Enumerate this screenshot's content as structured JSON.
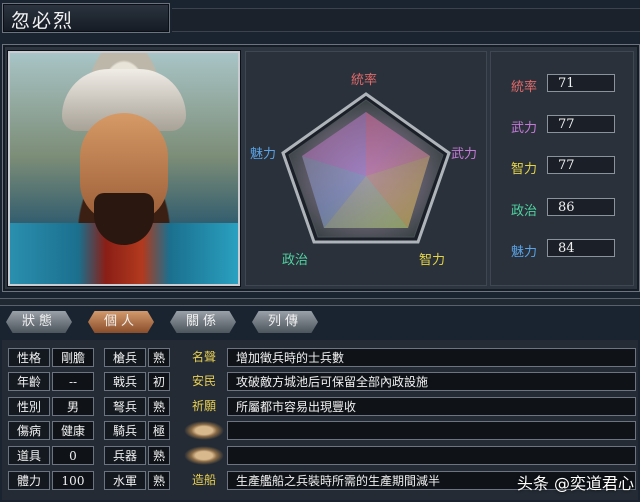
{
  "character": {
    "name": "忽必烈"
  },
  "radar": {
    "labels": {
      "top": "統率",
      "right": "武力",
      "bottom_right": "智力",
      "bottom_left": "政治",
      "left": "魅力"
    },
    "colors": {
      "top": "#e06a6a",
      "right": "#c57ad8",
      "bottom_right": "#e4d447",
      "bottom_left": "#4fd3a0",
      "left": "#5aa3e6"
    }
  },
  "stats": [
    {
      "label": "統率",
      "value": "71",
      "color": "#e06a6a"
    },
    {
      "label": "武力",
      "value": "77",
      "color": "#c57ad8"
    },
    {
      "label": "智力",
      "value": "77",
      "color": "#e4d447"
    },
    {
      "label": "政治",
      "value": "86",
      "color": "#4fd3a0"
    },
    {
      "label": "魅力",
      "value": "84",
      "color": "#5aa3e6"
    }
  ],
  "tabs": [
    "狀態",
    "個人",
    "關係",
    "列傳"
  ],
  "active_tab": "個人",
  "personal": [
    {
      "label": "性格",
      "value": "剛膽"
    },
    {
      "label": "年齡",
      "value": "--"
    },
    {
      "label": "性別",
      "value": "男"
    },
    {
      "label": "傷病",
      "value": "健康"
    },
    {
      "label": "道具",
      "value": "0"
    },
    {
      "label": "體力",
      "value": "100"
    }
  ],
  "aptitudes": [
    {
      "label": "槍兵",
      "value": "熟"
    },
    {
      "label": "戟兵",
      "value": "初"
    },
    {
      "label": "弩兵",
      "value": "熟"
    },
    {
      "label": "騎兵",
      "value": "極"
    },
    {
      "label": "兵器",
      "value": "熟"
    },
    {
      "label": "水軍",
      "value": "熟"
    }
  ],
  "skills": [
    {
      "name": "名聲",
      "desc": "增加徵兵時的士兵數"
    },
    {
      "name": "安民",
      "desc": "攻破敵方城池后可保留全部內政設施"
    },
    {
      "name": "祈願",
      "desc": "所屬都市容易出現豐收"
    },
    {
      "name": "",
      "desc": ""
    },
    {
      "name": "",
      "desc": ""
    },
    {
      "name": "造船",
      "desc": "生產艦船之兵裝時所需的生產期間減半"
    }
  ],
  "watermark": "头条 @奕道君心"
}
